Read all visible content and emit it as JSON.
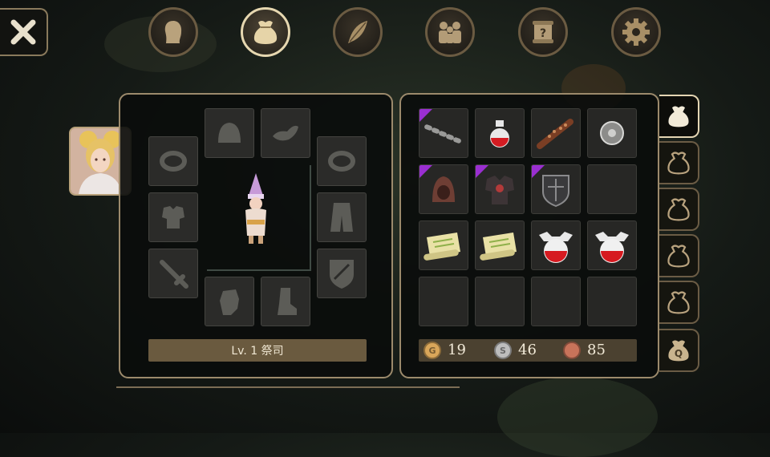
{
  "nav": {
    "close": "close-icon",
    "tabs": [
      {
        "icon": "character-head-icon",
        "active": false
      },
      {
        "icon": "bag-icon",
        "active": true
      },
      {
        "icon": "skill-feather-icon",
        "active": false
      },
      {
        "icon": "party-icon",
        "active": false
      },
      {
        "icon": "quest-scroll-icon",
        "active": false
      },
      {
        "icon": "gear-icon",
        "active": false
      }
    ]
  },
  "equipment": {
    "level_label": "Lv. 1 祭司",
    "slots": [
      "helmet",
      "accessory",
      "ring-left",
      "ring-right",
      "armor",
      "robe",
      "weapon",
      "shield",
      "gloves",
      "boots"
    ]
  },
  "inventory": {
    "items": [
      {
        "name": "chain-whip",
        "rare": true
      },
      {
        "name": "red-potion-small",
        "rare": false
      },
      {
        "name": "spiked-club",
        "rare": false
      },
      {
        "name": "round-buckler",
        "rare": false
      },
      {
        "name": "leather-hood",
        "rare": true
      },
      {
        "name": "dark-armor",
        "rare": true
      },
      {
        "name": "dark-shield",
        "rare": true
      },
      {
        "name": "",
        "rare": false
      },
      {
        "name": "scroll",
        "rare": false
      },
      {
        "name": "scroll",
        "rare": false
      },
      {
        "name": "red-potion-large",
        "rare": false
      },
      {
        "name": "red-potion-large",
        "rare": false
      },
      {
        "name": "",
        "rare": false
      },
      {
        "name": "",
        "rare": false
      },
      {
        "name": "",
        "rare": false
      },
      {
        "name": "",
        "rare": false
      }
    ],
    "currency": {
      "gold": "19",
      "silver": "46",
      "copper": "85",
      "gold_mark": "G",
      "silver_mark": "S",
      "colors": {
        "gold": "#d9a65a",
        "silver": "#bdbdbd",
        "copper": "#c8735a"
      }
    },
    "bag_tabs": [
      {
        "icon": "bag-icon",
        "active": true
      },
      {
        "icon": "bag-icon",
        "active": false
      },
      {
        "icon": "bag-icon",
        "active": false
      },
      {
        "icon": "bag-icon",
        "active": false
      },
      {
        "icon": "bag-icon",
        "active": false
      },
      {
        "icon": "quest-bag-icon",
        "label": "Q",
        "active": false
      }
    ]
  }
}
